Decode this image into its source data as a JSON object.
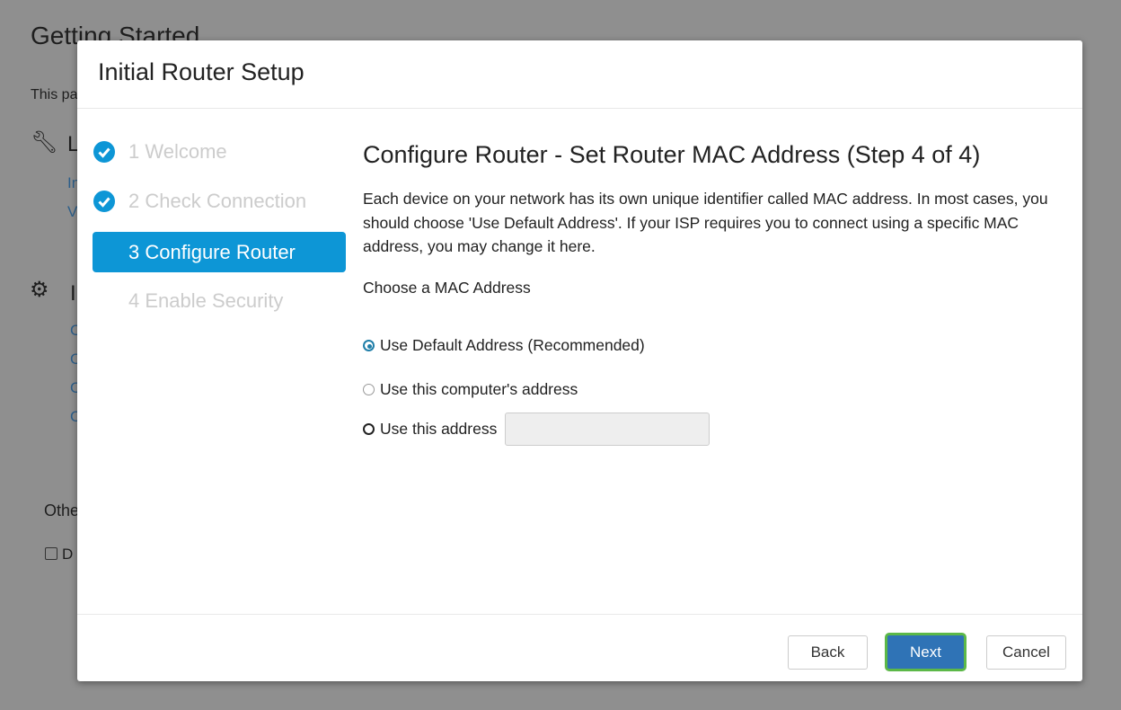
{
  "background": {
    "title": "Getting Started",
    "intro": "This pa",
    "section1_heading": "L",
    "section1_links": [
      "In",
      "V"
    ],
    "section2_heading": "I",
    "section2_links": [
      "C",
      "C",
      "C",
      "C"
    ],
    "other": "Othe",
    "checkbox_label": "D"
  },
  "modal": {
    "title": "Initial Router Setup",
    "steps": [
      {
        "label": "1 Welcome",
        "state": "done"
      },
      {
        "label": "2 Check Connection",
        "state": "done"
      },
      {
        "label": "3 Configure Router",
        "state": "active"
      },
      {
        "label": "4 Enable Security",
        "state": "pending"
      }
    ],
    "heading": "Configure Router - Set Router MAC Address (Step 4 of 4)",
    "description": "Each device on your network has its own unique identifier called MAC address. In most cases, you should choose 'Use Default Address'. If your ISP requires you to connect using a specific MAC address, you may change it here.",
    "choose_label": "Choose a MAC Address",
    "options": [
      {
        "label": "Use Default Address (Recommended)",
        "selected": true
      },
      {
        "label": "Use this computer's address",
        "selected": false
      },
      {
        "label": "Use this address",
        "selected": false
      }
    ],
    "address_value": "",
    "buttons": {
      "back": "Back",
      "next": "Next",
      "cancel": "Cancel"
    },
    "colors": {
      "accent": "#0d96d6",
      "next": "#2f73b6",
      "focus": "#5cb848"
    }
  }
}
